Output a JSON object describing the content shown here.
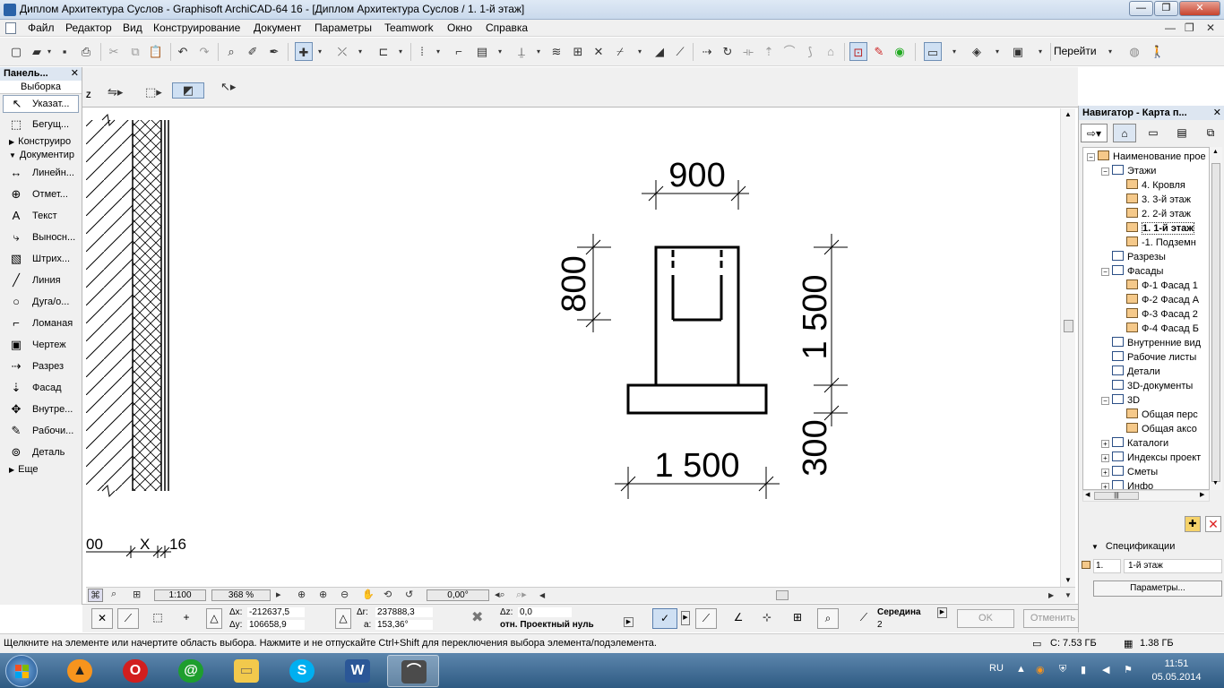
{
  "window": {
    "title": "Диплом Архитектура Суслов - Graphisoft ArchiCAD-64 16 - [Диплом Архитектура Суслов / 1. 1-й этаж]",
    "minimize": "—",
    "restore": "❐",
    "close": "✕"
  },
  "menu": [
    "Файл",
    "Редактор",
    "Вид",
    "Конструирование",
    "Документ",
    "Параметры",
    "Teamwork",
    "Окно",
    "Справка"
  ],
  "mdi_controls": [
    "—",
    "❐",
    "✕"
  ],
  "toolbar": {
    "goto_label": "Перейти"
  },
  "toolbox": {
    "title": "Панель...",
    "close": "✕",
    "selection_label": "Выборка",
    "tools_top": [
      {
        "label": "Указат...",
        "icon": "arrow-pointer-icon",
        "glyph": "↖"
      },
      {
        "label": "Бегущ...",
        "icon": "marquee-icon",
        "glyph": "⬚"
      }
    ],
    "group_construct": "Конструиро",
    "group_document": "Документир",
    "tools_doc": [
      {
        "label": "Линейн...",
        "icon": "linear-dimension-icon",
        "glyph": "↔"
      },
      {
        "label": "Отмет...",
        "icon": "level-dimension-icon",
        "glyph": "⊕"
      },
      {
        "label": "Текст",
        "icon": "text-icon",
        "glyph": "A"
      },
      {
        "label": "Выносн...",
        "icon": "label-icon",
        "glyph": "⤷"
      },
      {
        "label": "Штрих...",
        "icon": "fill-icon",
        "glyph": "▧"
      },
      {
        "label": "Линия",
        "icon": "line-icon",
        "glyph": "╱"
      },
      {
        "label": "Дуга/о...",
        "icon": "arc-icon",
        "glyph": "○"
      },
      {
        "label": "Ломаная",
        "icon": "polyline-icon",
        "glyph": "⌐"
      },
      {
        "label": "Чертеж",
        "icon": "drawing-icon",
        "glyph": "▣"
      },
      {
        "label": "Разрез",
        "icon": "section-icon",
        "glyph": "⇢"
      },
      {
        "label": "Фасад",
        "icon": "elevation-icon",
        "glyph": "⇣"
      },
      {
        "label": "Внутре...",
        "icon": "interior-elevation-icon",
        "glyph": "✥"
      },
      {
        "label": "Рабочи...",
        "icon": "worksheet-icon",
        "glyph": "✎"
      },
      {
        "label": "Деталь",
        "icon": "detail-icon",
        "glyph": "⊚"
      }
    ],
    "group_more": "Еще"
  },
  "drawing": {
    "dim_top": "900",
    "dim_left": "800",
    "dim_right_upper": "1 500",
    "dim_right_lower": "300",
    "dim_bottom": "1 500",
    "dim_small_1": "00",
    "dim_small_2": "X",
    "dim_small_3": "16"
  },
  "viewbar": {
    "scale": "1:100",
    "zoom": "368 %",
    "angle": "0,00°"
  },
  "coords": {
    "dx_label": "Δx:",
    "dx": "-212637,5",
    "dy_label": "Δy:",
    "dy": "106658,9",
    "dr_label": "Δr:",
    "dr": "237888,3",
    "a_label": "a:",
    "a": "153,36°",
    "dz_label": "Δz:",
    "dz": "0,0",
    "ref": "отн. Проектный нуль",
    "snap_label": "Середина",
    "snap_value": "2",
    "ok": "OK",
    "cancel": "Отменить"
  },
  "navigator": {
    "title": "Навигатор - Карта п...",
    "close": "✕",
    "tree": [
      {
        "label": "Наименование прое",
        "depth": 0,
        "expander": "−",
        "icon": "project-icon"
      },
      {
        "label": "Этажи",
        "depth": 1,
        "expander": "−",
        "icon": "stories-icon"
      },
      {
        "label": "4. Кровля",
        "depth": 2,
        "expander": "",
        "icon": "story-icon"
      },
      {
        "label": "3. 3-й этаж",
        "depth": 2,
        "expander": "",
        "icon": "story-icon"
      },
      {
        "label": "2. 2-й этаж",
        "depth": 2,
        "expander": "",
        "icon": "story-icon"
      },
      {
        "label": "1. 1-й этаж",
        "depth": 2,
        "expander": "",
        "icon": "story-icon",
        "selected": true
      },
      {
        "label": "-1. Подземн",
        "depth": 2,
        "expander": "",
        "icon": "story-icon"
      },
      {
        "label": "Разрезы",
        "depth": 1,
        "expander": "",
        "icon": "sections-icon"
      },
      {
        "label": "Фасады",
        "depth": 1,
        "expander": "−",
        "icon": "elevations-icon"
      },
      {
        "label": "Ф-1 Фасад 1",
        "depth": 2,
        "expander": "",
        "icon": "elevation-view-icon"
      },
      {
        "label": "Ф-2 Фасад А",
        "depth": 2,
        "expander": "",
        "icon": "elevation-view-icon"
      },
      {
        "label": "Ф-3 Фасад 2",
        "depth": 2,
        "expander": "",
        "icon": "elevation-view-icon"
      },
      {
        "label": "Ф-4 Фасад Б",
        "depth": 2,
        "expander": "",
        "icon": "elevation-view-icon"
      },
      {
        "label": "Внутренние вид",
        "depth": 1,
        "expander": "",
        "icon": "interior-icon"
      },
      {
        "label": "Рабочие листы",
        "depth": 1,
        "expander": "",
        "icon": "worksheets-icon"
      },
      {
        "label": "Детали",
        "depth": 1,
        "expander": "",
        "icon": "details-icon"
      },
      {
        "label": "3D-документы",
        "depth": 1,
        "expander": "",
        "icon": "3d-docs-icon"
      },
      {
        "label": "3D",
        "depth": 1,
        "expander": "−",
        "icon": "3d-icon"
      },
      {
        "label": "Общая перс",
        "depth": 2,
        "expander": "",
        "icon": "perspective-icon"
      },
      {
        "label": "Общая аксо",
        "depth": 2,
        "expander": "",
        "icon": "axonometry-icon"
      },
      {
        "label": "Каталоги",
        "depth": 1,
        "expander": "+",
        "icon": "catalogs-icon"
      },
      {
        "label": "Индексы проект",
        "depth": 1,
        "expander": "+",
        "icon": "indexes-icon"
      },
      {
        "label": "Сметы",
        "depth": 1,
        "expander": "+",
        "icon": "estimates-icon"
      },
      {
        "label": "Инфо",
        "depth": 1,
        "expander": "+",
        "icon": "info-icon"
      }
    ],
    "specs_label": "Спецификации",
    "spec_key": "1.",
    "spec_value": "1-й этаж",
    "params_button": "Параметры..."
  },
  "status": {
    "message": "Щелкните на элементе или начертите область выбора. Нажмите и не отпускайте Ctrl+Shift для переключения выбора элемента/подэлемента.",
    "disk": "C: 7.53 ГБ",
    "memory": "1.38 ГБ"
  },
  "taskbar": {
    "lang": "RU",
    "time": "11:51",
    "date": "05.05.2014"
  }
}
